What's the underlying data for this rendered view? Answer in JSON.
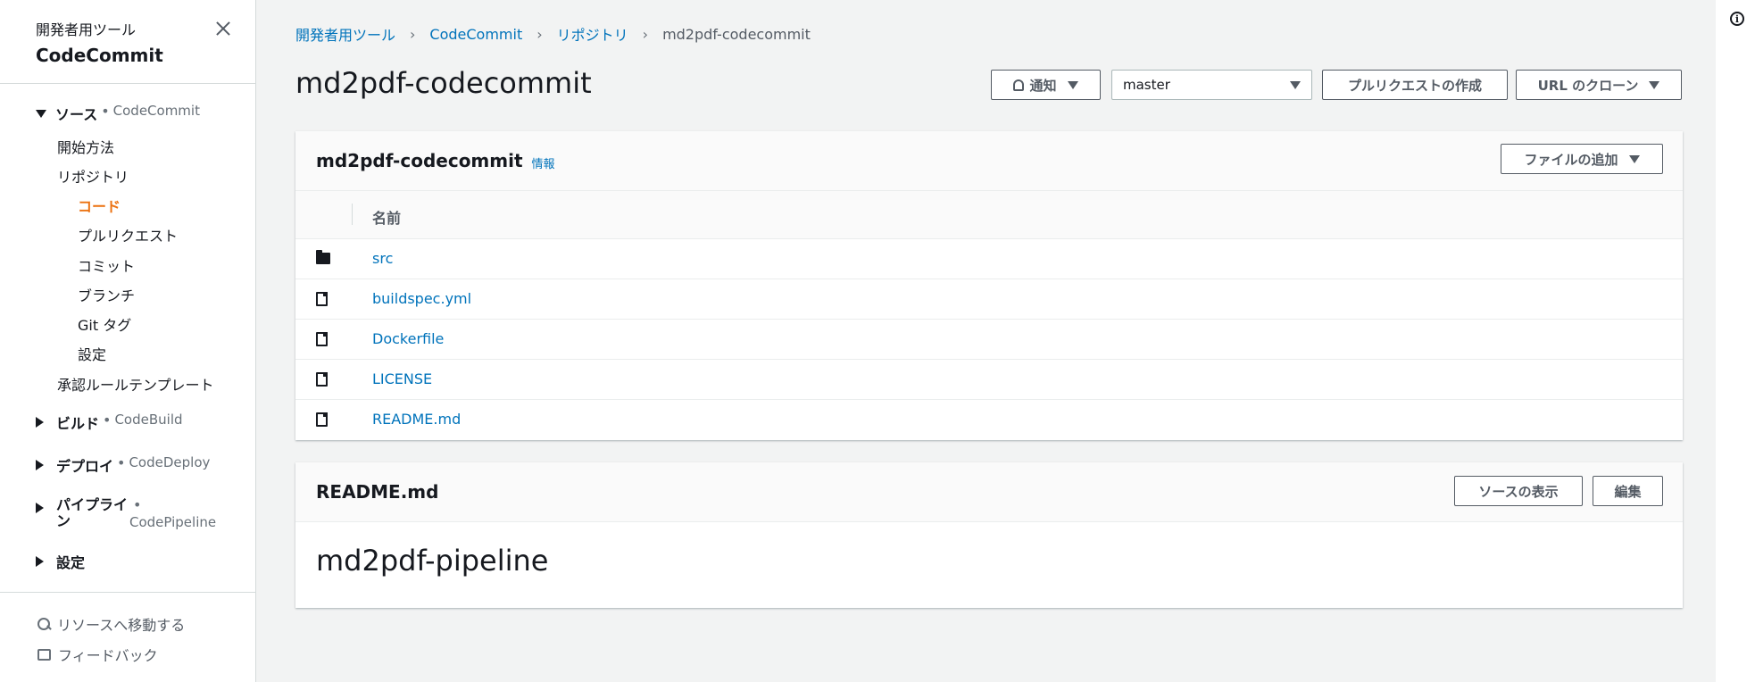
{
  "sidebar": {
    "subtitle": "開発者用ツール",
    "title": "CodeCommit",
    "groups": [
      {
        "label": "ソース",
        "service": "CodeCommit"
      },
      {
        "label": "ビルド",
        "service": "CodeBuild"
      },
      {
        "label": "デプロイ",
        "service": "CodeDeploy"
      },
      {
        "label": "パイプライン",
        "service": "CodePipeline"
      },
      {
        "label": "設定"
      }
    ],
    "items": {
      "getting_started": "開始方法",
      "repositories": "リポジトリ",
      "code": "コード",
      "pull_requests": "プルリクエスト",
      "commits": "コミット",
      "branches": "ブランチ",
      "git_tags": "Git タグ",
      "settings": "設定",
      "approval_templates": "承認ルールテンプレート"
    },
    "footer": {
      "goto_resource": "リソースへ移動する",
      "feedback": "フィードバック"
    }
  },
  "breadcrumb": [
    "開発者用ツール",
    "CodeCommit",
    "リポジトリ",
    "md2pdf-codecommit"
  ],
  "page_title": "md2pdf-codecommit",
  "toolbar": {
    "notify": "通知",
    "branch": "master",
    "create_pr": "プルリクエストの作成",
    "clone_url": "URL のクローン"
  },
  "files_panel": {
    "title": "md2pdf-codecommit",
    "info": "情報",
    "add_file": "ファイルの追加",
    "column_name": "名前",
    "rows": [
      {
        "name": "src",
        "type": "folder"
      },
      {
        "name": "buildspec.yml",
        "type": "file"
      },
      {
        "name": "Dockerfile",
        "type": "file"
      },
      {
        "name": "LICENSE",
        "type": "file"
      },
      {
        "name": "README.md",
        "type": "file"
      }
    ]
  },
  "readme_panel": {
    "title": "README.md",
    "view_source": "ソースの表示",
    "edit": "編集",
    "heading": "md2pdf-pipeline"
  },
  "colors": {
    "link": "#0073bb",
    "active": "#ec7211",
    "background": "#f2f3f3"
  }
}
